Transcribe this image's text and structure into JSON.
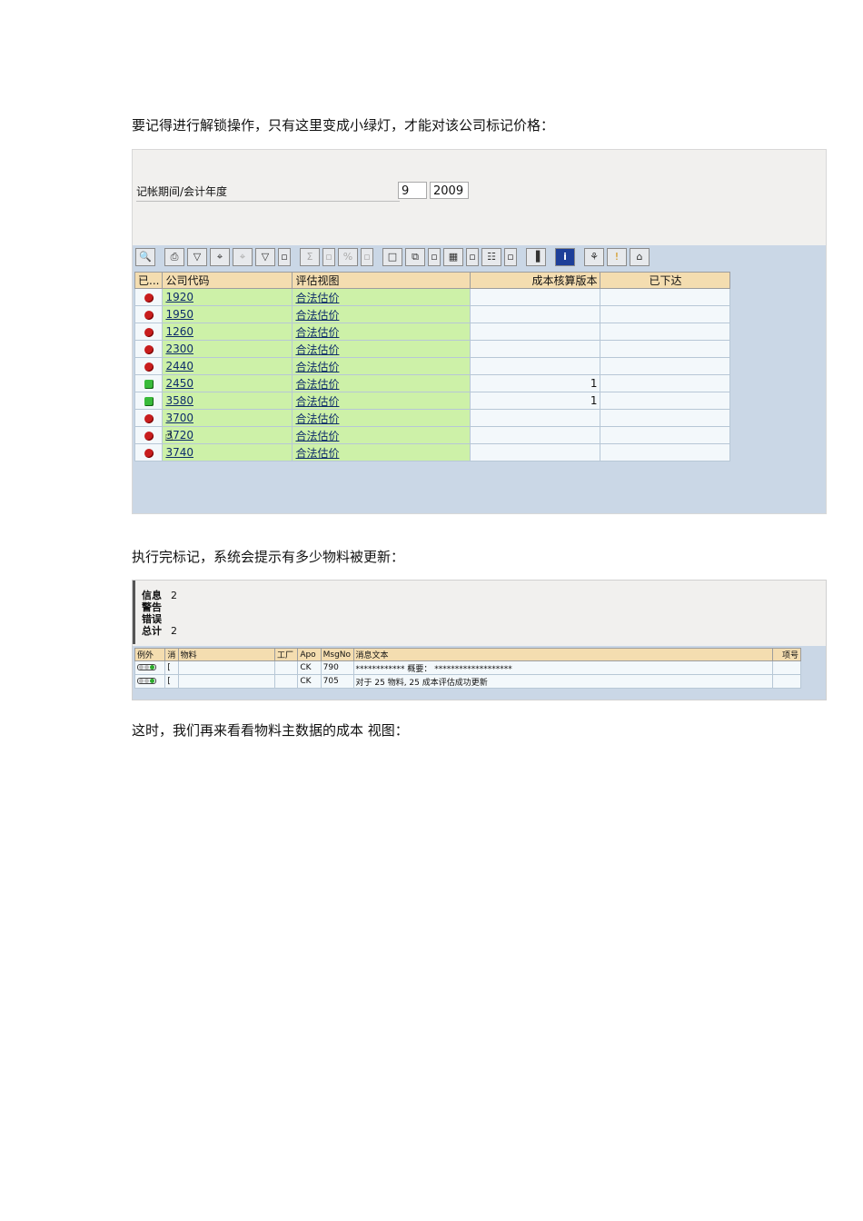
{
  "paragraphs": {
    "p1": "要记得进行解锁操作，只有这里变成小绿灯，才能对该公司标记价格：",
    "p2": "执行完标记，系统会提示有多少物料被更新：",
    "p3": "这时，我们再来看看物料主数据的成本 视图："
  },
  "screen1": {
    "period_label": "记帐期间/会计年度",
    "period": "9",
    "year": "2009",
    "toolbar": [
      "detail-icon",
      "print-icon",
      "filter-icon",
      "find-icon",
      "find-next-icon",
      "set-filter-icon",
      "dropdown-icon",
      "sum-icon",
      "dropdown-icon",
      "subtotal-icon",
      "dropdown-icon",
      "print-preview-icon",
      "export-icon",
      "dropdown-icon",
      "spreadsheet-icon",
      "dropdown-icon",
      "layout-icon",
      "dropdown-icon",
      "graphic-icon",
      "info-icon",
      "release-icon",
      "unlock-icon",
      "mark-icon"
    ],
    "columns": [
      "已...",
      "公司代码",
      "评估视图",
      "成本核算版本",
      "已下达"
    ],
    "rows": [
      {
        "status": "red",
        "code": "1920",
        "view": "合法估价",
        "version": "",
        "released": ""
      },
      {
        "status": "red",
        "code": "1950",
        "view": "合法估价",
        "version": "",
        "released": ""
      },
      {
        "status": "red",
        "code": "1260",
        "view": "合法估价",
        "version": "",
        "released": ""
      },
      {
        "status": "red",
        "code": "2300",
        "view": "合法估价",
        "version": "",
        "released": ""
      },
      {
        "status": "red",
        "code": "2440",
        "view": "合法估价",
        "version": "",
        "released": ""
      },
      {
        "status": "green",
        "code": "2450",
        "view": "合法估价",
        "version": "1",
        "released": ""
      },
      {
        "status": "green",
        "code": "3580",
        "view": "合法估价",
        "version": "1",
        "released": ""
      },
      {
        "status": "red",
        "code": "3700",
        "view": "合法估价",
        "version": "",
        "released": ""
      },
      {
        "status": "red",
        "code": "3720",
        "view": "合法估价",
        "version": "",
        "released": ""
      },
      {
        "status": "red",
        "code": "3740",
        "view": "合法估价",
        "version": "",
        "released": ""
      }
    ],
    "colors": {
      "header": "#f4ddb0",
      "key_cell": "#cdf1a8",
      "lower_bg": "#cad7e6",
      "red_lamp": "#c81d1d",
      "green_lamp": "#39bb3a"
    }
  },
  "screen2": {
    "summary": [
      {
        "label": "信息",
        "value": "2"
      },
      {
        "label": "警告",
        "value": ""
      },
      {
        "label": "错误",
        "value": ""
      },
      {
        "label": "总计",
        "value": "2"
      }
    ],
    "columns": [
      "例外",
      "消",
      "物料",
      "工厂",
      "Apo",
      "MsgNo",
      "消息文本",
      "项号"
    ],
    "rows": [
      {
        "x": "[",
        "material": "",
        "plant": "",
        "apo": "CK",
        "msgno": "790",
        "text": "************  概要：        *******************",
        "item": ""
      },
      {
        "x": "[",
        "material": "",
        "plant": "",
        "apo": "CK",
        "msgno": "705",
        "text": "对于 25 物料, 25 成本评估成功更新",
        "item": ""
      }
    ]
  }
}
